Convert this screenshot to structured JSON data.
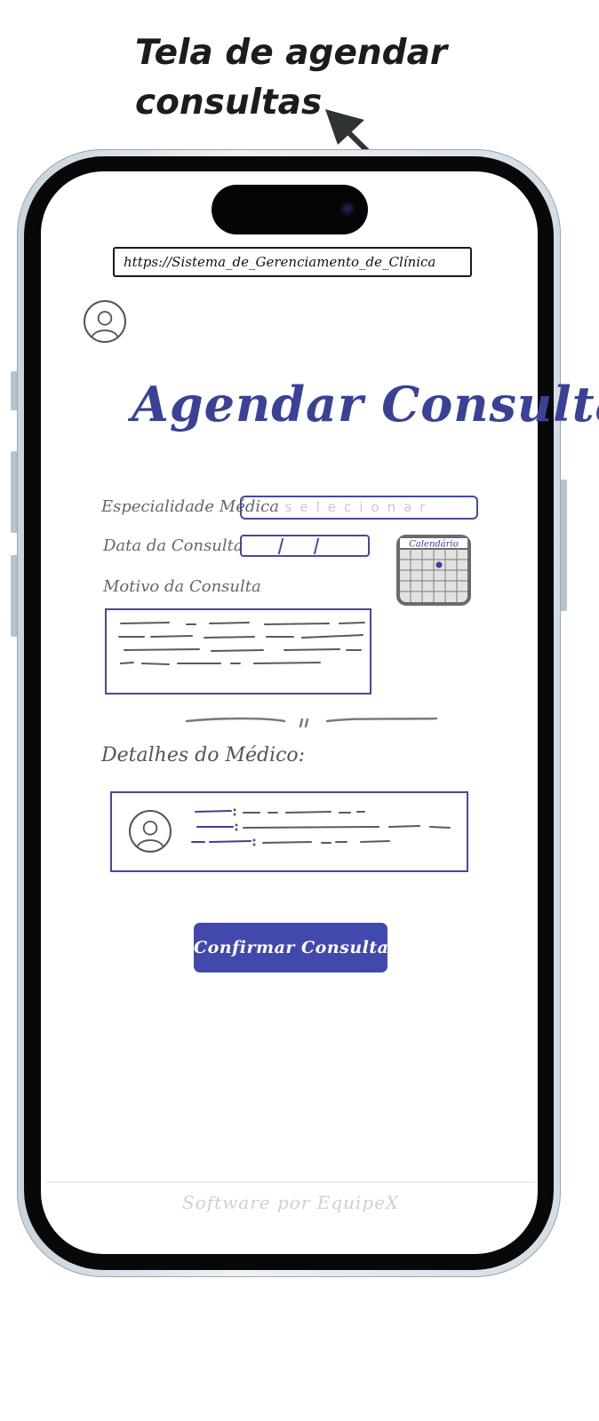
{
  "caption": {
    "line1": "Tela de agendar",
    "line2": "consultas"
  },
  "browser": {
    "url": "https://Sistema_de_Gerenciamento_de_Clínica"
  },
  "page": {
    "title": "Agendar Consulta"
  },
  "form": {
    "especialidade_label": "Especialidade Médica",
    "especialidade_placeholder": "selecionar",
    "data_label": "Data da Consulta",
    "calendar_label": "Calendário",
    "motivo_label": "Motivo da Consulta"
  },
  "medico": {
    "section_label": "Detalhes do Médico:"
  },
  "actions": {
    "confirm_label": "Confirmar Consulta"
  },
  "footer": {
    "text": "Software por EquipeX"
  },
  "colors": {
    "accent": "#4249ad",
    "border": "#454a9c",
    "title": "#3b4196"
  },
  "icons": {
    "profile": "user-avatar-icon",
    "calendar": "calendar-icon",
    "arrow": "arrow-up-left-icon"
  }
}
